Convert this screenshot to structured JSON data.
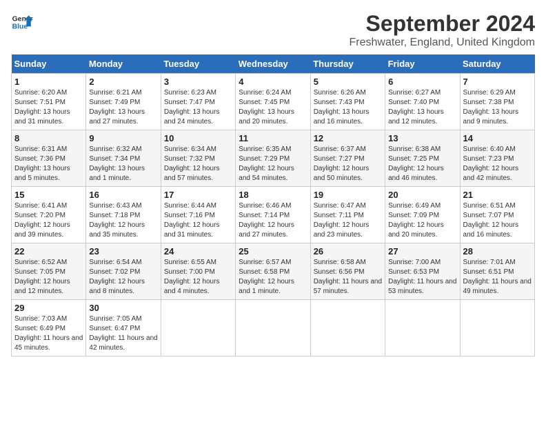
{
  "logo": {
    "line1": "General",
    "line2": "Blue"
  },
  "title": "September 2024",
  "location": "Freshwater, England, United Kingdom",
  "days_of_week": [
    "Sunday",
    "Monday",
    "Tuesday",
    "Wednesday",
    "Thursday",
    "Friday",
    "Saturday"
  ],
  "weeks": [
    [
      {
        "day": "1",
        "sunrise": "Sunrise: 6:20 AM",
        "sunset": "Sunset: 7:51 PM",
        "daylight": "Daylight: 13 hours and 31 minutes."
      },
      {
        "day": "2",
        "sunrise": "Sunrise: 6:21 AM",
        "sunset": "Sunset: 7:49 PM",
        "daylight": "Daylight: 13 hours and 27 minutes."
      },
      {
        "day": "3",
        "sunrise": "Sunrise: 6:23 AM",
        "sunset": "Sunset: 7:47 PM",
        "daylight": "Daylight: 13 hours and 24 minutes."
      },
      {
        "day": "4",
        "sunrise": "Sunrise: 6:24 AM",
        "sunset": "Sunset: 7:45 PM",
        "daylight": "Daylight: 13 hours and 20 minutes."
      },
      {
        "day": "5",
        "sunrise": "Sunrise: 6:26 AM",
        "sunset": "Sunset: 7:43 PM",
        "daylight": "Daylight: 13 hours and 16 minutes."
      },
      {
        "day": "6",
        "sunrise": "Sunrise: 6:27 AM",
        "sunset": "Sunset: 7:40 PM",
        "daylight": "Daylight: 13 hours and 12 minutes."
      },
      {
        "day": "7",
        "sunrise": "Sunrise: 6:29 AM",
        "sunset": "Sunset: 7:38 PM",
        "daylight": "Daylight: 13 hours and 9 minutes."
      }
    ],
    [
      {
        "day": "8",
        "sunrise": "Sunrise: 6:31 AM",
        "sunset": "Sunset: 7:36 PM",
        "daylight": "Daylight: 13 hours and 5 minutes."
      },
      {
        "day": "9",
        "sunrise": "Sunrise: 6:32 AM",
        "sunset": "Sunset: 7:34 PM",
        "daylight": "Daylight: 13 hours and 1 minute."
      },
      {
        "day": "10",
        "sunrise": "Sunrise: 6:34 AM",
        "sunset": "Sunset: 7:32 PM",
        "daylight": "Daylight: 12 hours and 57 minutes."
      },
      {
        "day": "11",
        "sunrise": "Sunrise: 6:35 AM",
        "sunset": "Sunset: 7:29 PM",
        "daylight": "Daylight: 12 hours and 54 minutes."
      },
      {
        "day": "12",
        "sunrise": "Sunrise: 6:37 AM",
        "sunset": "Sunset: 7:27 PM",
        "daylight": "Daylight: 12 hours and 50 minutes."
      },
      {
        "day": "13",
        "sunrise": "Sunrise: 6:38 AM",
        "sunset": "Sunset: 7:25 PM",
        "daylight": "Daylight: 12 hours and 46 minutes."
      },
      {
        "day": "14",
        "sunrise": "Sunrise: 6:40 AM",
        "sunset": "Sunset: 7:23 PM",
        "daylight": "Daylight: 12 hours and 42 minutes."
      }
    ],
    [
      {
        "day": "15",
        "sunrise": "Sunrise: 6:41 AM",
        "sunset": "Sunset: 7:20 PM",
        "daylight": "Daylight: 12 hours and 39 minutes."
      },
      {
        "day": "16",
        "sunrise": "Sunrise: 6:43 AM",
        "sunset": "Sunset: 7:18 PM",
        "daylight": "Daylight: 12 hours and 35 minutes."
      },
      {
        "day": "17",
        "sunrise": "Sunrise: 6:44 AM",
        "sunset": "Sunset: 7:16 PM",
        "daylight": "Daylight: 12 hours and 31 minutes."
      },
      {
        "day": "18",
        "sunrise": "Sunrise: 6:46 AM",
        "sunset": "Sunset: 7:14 PM",
        "daylight": "Daylight: 12 hours and 27 minutes."
      },
      {
        "day": "19",
        "sunrise": "Sunrise: 6:47 AM",
        "sunset": "Sunset: 7:11 PM",
        "daylight": "Daylight: 12 hours and 23 minutes."
      },
      {
        "day": "20",
        "sunrise": "Sunrise: 6:49 AM",
        "sunset": "Sunset: 7:09 PM",
        "daylight": "Daylight: 12 hours and 20 minutes."
      },
      {
        "day": "21",
        "sunrise": "Sunrise: 6:51 AM",
        "sunset": "Sunset: 7:07 PM",
        "daylight": "Daylight: 12 hours and 16 minutes."
      }
    ],
    [
      {
        "day": "22",
        "sunrise": "Sunrise: 6:52 AM",
        "sunset": "Sunset: 7:05 PM",
        "daylight": "Daylight: 12 hours and 12 minutes."
      },
      {
        "day": "23",
        "sunrise": "Sunrise: 6:54 AM",
        "sunset": "Sunset: 7:02 PM",
        "daylight": "Daylight: 12 hours and 8 minutes."
      },
      {
        "day": "24",
        "sunrise": "Sunrise: 6:55 AM",
        "sunset": "Sunset: 7:00 PM",
        "daylight": "Daylight: 12 hours and 4 minutes."
      },
      {
        "day": "25",
        "sunrise": "Sunrise: 6:57 AM",
        "sunset": "Sunset: 6:58 PM",
        "daylight": "Daylight: 12 hours and 1 minute."
      },
      {
        "day": "26",
        "sunrise": "Sunrise: 6:58 AM",
        "sunset": "Sunset: 6:56 PM",
        "daylight": "Daylight: 11 hours and 57 minutes."
      },
      {
        "day": "27",
        "sunrise": "Sunrise: 7:00 AM",
        "sunset": "Sunset: 6:53 PM",
        "daylight": "Daylight: 11 hours and 53 minutes."
      },
      {
        "day": "28",
        "sunrise": "Sunrise: 7:01 AM",
        "sunset": "Sunset: 6:51 PM",
        "daylight": "Daylight: 11 hours and 49 minutes."
      }
    ],
    [
      {
        "day": "29",
        "sunrise": "Sunrise: 7:03 AM",
        "sunset": "Sunset: 6:49 PM",
        "daylight": "Daylight: 11 hours and 45 minutes."
      },
      {
        "day": "30",
        "sunrise": "Sunrise: 7:05 AM",
        "sunset": "Sunset: 6:47 PM",
        "daylight": "Daylight: 11 hours and 42 minutes."
      },
      null,
      null,
      null,
      null,
      null
    ]
  ]
}
